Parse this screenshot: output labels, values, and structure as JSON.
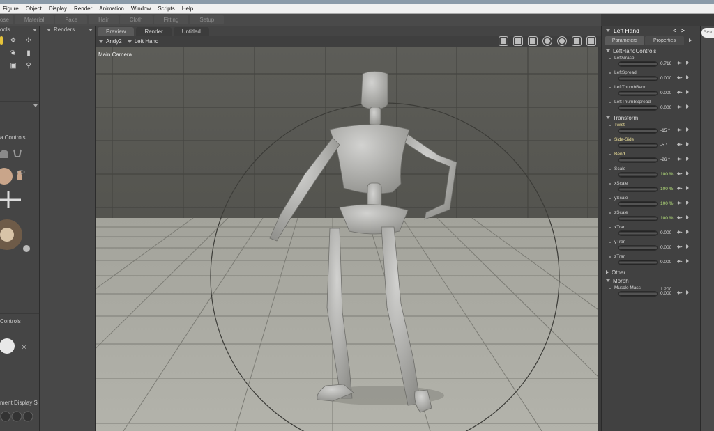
{
  "window": {
    "title_fragment": ""
  },
  "menu": [
    "Figure",
    "Object",
    "Display",
    "Render",
    "Animation",
    "Window",
    "Scripts",
    "Help"
  ],
  "rooms": [
    "ose",
    "Material",
    "Face",
    "Hair",
    "Cloth",
    "Fitting",
    "Setup"
  ],
  "left_panel": {
    "title": "ools",
    "section_label": "a Controls",
    "lower_section_label": "Controls",
    "bottom_label": "ment Display S"
  },
  "renders_panel": {
    "title": "Renders"
  },
  "view_tabs": [
    "Preview",
    "Render",
    "Untitled"
  ],
  "viewport_toolbar": {
    "figure_select": "Andy2",
    "actor_select": "Left Hand"
  },
  "camera_label": "Main Camera",
  "right_panel": {
    "actor": "Left Hand",
    "nav": "< >",
    "tabs": [
      "Parameters",
      "Properties"
    ],
    "groups": [
      {
        "name": "LeftHandControls",
        "params": [
          {
            "name": "LeftGrasp",
            "value": "0.716",
            "style": "normal"
          },
          {
            "name": "LeftSpread",
            "value": "0.000",
            "style": "normal"
          },
          {
            "name": "LeftThumbBend",
            "value": "0.000",
            "style": "normal"
          },
          {
            "name": "LeftThumbSpread",
            "value": "0.000",
            "style": "normal"
          }
        ]
      },
      {
        "name": "Transform",
        "params": [
          {
            "name": "Twist",
            "value": "-15 °",
            "style": "yellow"
          },
          {
            "name": "Side-Side",
            "value": "-5 °",
            "style": "yellow"
          },
          {
            "name": "Bend",
            "value": "-26 °",
            "style": "yellow"
          },
          {
            "name": "Scale",
            "value": "100 %",
            "style": "green"
          },
          {
            "name": "xScale",
            "value": "100 %",
            "style": "green"
          },
          {
            "name": "yScale",
            "value": "100 %",
            "style": "green"
          },
          {
            "name": "zScale",
            "value": "100 %",
            "style": "green"
          },
          {
            "name": "xTran",
            "value": "0.000",
            "style": "normal"
          },
          {
            "name": "yTran",
            "value": "0.000",
            "style": "normal"
          },
          {
            "name": "zTran",
            "value": "0.000",
            "style": "normal"
          }
        ]
      },
      {
        "name": "Other",
        "params": []
      },
      {
        "name": "Morph",
        "params": [
          {
            "name": "Muscle Mass",
            "value": "0.000",
            "extra": "1.200",
            "style": "normal"
          }
        ]
      }
    ]
  },
  "search": {
    "placeholder": "Sea"
  },
  "colors": {
    "accent_yellow": "#e6c33a",
    "viewport_bg": "#6f6f6a",
    "panel_bg": "#414141"
  }
}
